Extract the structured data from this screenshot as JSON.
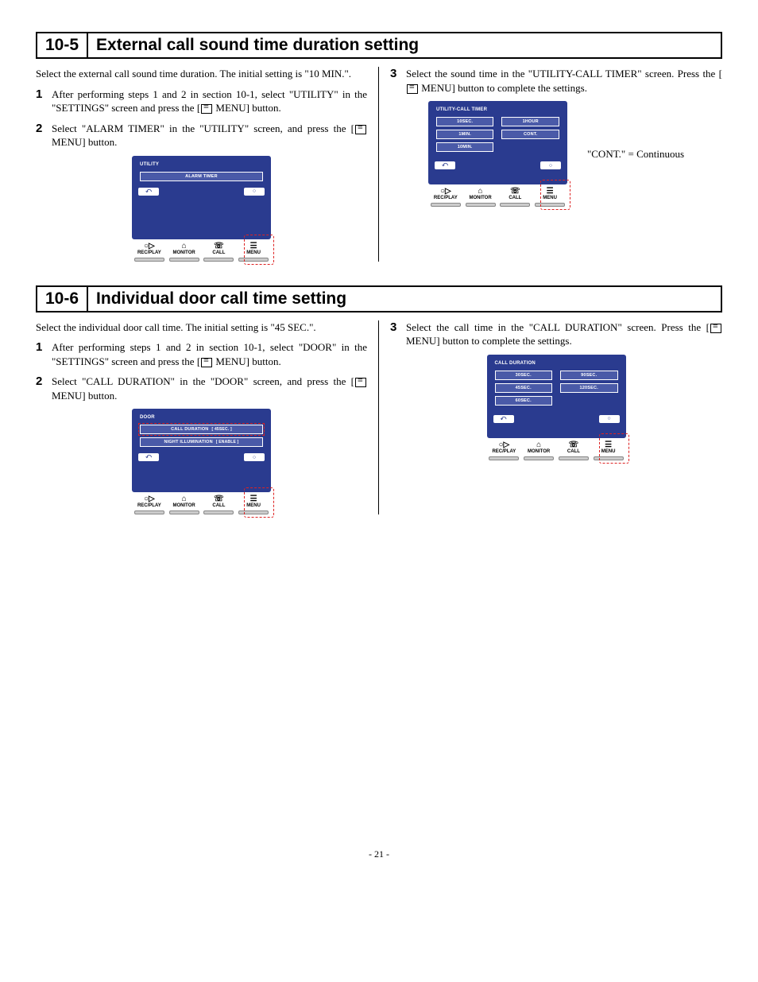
{
  "section105": {
    "number": "10-5",
    "title": "External call sound time duration setting",
    "intro": "Select the external call sound time duration. The initial setting is \"10 MIN.\".",
    "steps_left": [
      {
        "num": "1",
        "text_before": "After performing steps 1 and 2 in section 10-1, select \"UTILITY\" in the \"SETTINGS\" screen and press the [",
        "text_after": "MENU] button."
      },
      {
        "num": "2",
        "text_before": "Select \"ALARM TIMER\" in the \"UTILITY\" screen, and press the [",
        "text_after": "MENU] button."
      }
    ],
    "steps_right": [
      {
        "num": "3",
        "text_before": "Select the sound time in the \"UTILITY-CALL TIMER\" screen. Press the [",
        "text_after": "MENU] button to complete the settings."
      }
    ],
    "screen_left": {
      "title": "UTILITY",
      "buttons_left": [
        "ALARM TIMER"
      ],
      "buttons_right": []
    },
    "screen_right": {
      "title": "UTILITY-CALL TIMER",
      "buttons_left": [
        "10SEC.",
        "1MIN.",
        "10MIN."
      ],
      "buttons_right": [
        "1HOUR",
        "CONT."
      ]
    },
    "cont_note": "\"CONT.\" = Continuous"
  },
  "section106": {
    "number": "10-6",
    "title": "Individual door call time setting",
    "intro": "Select the individual door call time. The initial setting is \"45 SEC.\".",
    "steps_left": [
      {
        "num": "1",
        "text_before": "After performing steps 1 and 2 in section 10-1, select \"DOOR\" in the \"SETTINGS\" screen and press the [",
        "text_after": "MENU] button."
      },
      {
        "num": "2",
        "text_before": "Select \"CALL DURATION\" in the \"DOOR\" screen, and press the [",
        "text_after": "MENU] button."
      }
    ],
    "steps_right": [
      {
        "num": "3",
        "text_before": "Select the call time in the \"CALL DURATION\" screen.  Press the [",
        "text_after": "MENU] button to complete the settings."
      }
    ],
    "screen_left": {
      "title": "DOOR",
      "rows": [
        {
          "label": "CALL DURATION",
          "value": "[ 45SEC. ]",
          "highlight": true
        },
        {
          "label": "NIGHT ILLUMINATION",
          "value": "[ ENABLE ]",
          "highlight": false
        }
      ]
    },
    "screen_right": {
      "title": "CALL DURATION",
      "buttons_left": [
        "30SEC.",
        "45SEC.",
        "60SEC."
      ],
      "buttons_right": [
        "90SEC.",
        "120SEC."
      ]
    }
  },
  "device_labels": {
    "recplay": "REC/PLAY",
    "monitor": "MONITOR",
    "call": "CALL",
    "menu": "MENU"
  },
  "page_number": "- 21 -"
}
